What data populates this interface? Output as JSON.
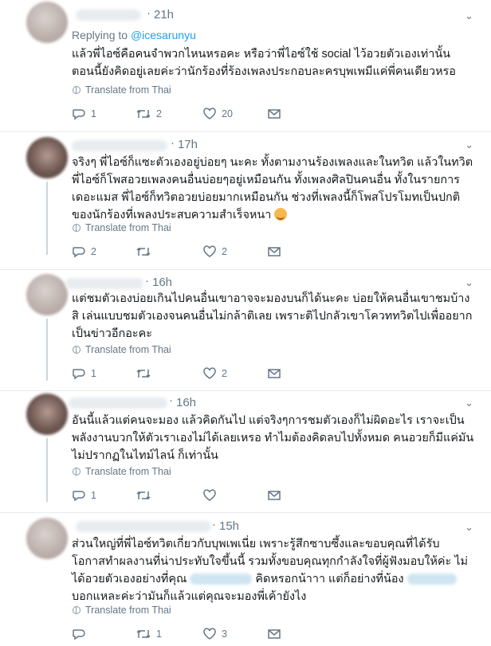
{
  "tweets": [
    {
      "time": "21h",
      "replying_prefix": "Replying to",
      "replying_handle": "@icesarunyu",
      "text": "แล้วพี่ไอซ์คือคนจำพวกไหนหรอคะ หรือว่าพี่ไอซ์ใช้ social ไว้อวยตัวเองเท่านั้น ตอนนี้ยังคิดอยู่เลยค่ะว่านักร้องที่ร้องเพลงประกอบละครบุพเพมีแค่พี่คนเดียวหรอ",
      "translate": "Translate from Thai",
      "replies": "1",
      "retweets": "2",
      "likes": "20"
    },
    {
      "time": "17h",
      "text_before": "จริงๆ พี่ไอซ์ก็แซะตัวเองอยู่บ่อยๆ นะคะ ทั้งตามงานร้องเพลงและในทวิต แล้วในทวิตพี่ไอซ์ก็โพสอวยเพลงคนอื่นบ่อยๆอยู่เหมือนกัน ทั้งเพลงศิลปินคนอื่น ทั้งในรายการเดอะแมส พี่ไอซ์ก็ทวิตอวยบ่อยมากเหมือนกัน ช่วงที่เพลงนี้ก็โพสโปรโมทเป็นปกติของนักร้องที่เพลงประสบความสำเร็จหนา",
      "translate": "Translate from Thai",
      "replies": "2",
      "retweets": "",
      "likes": "2"
    },
    {
      "time": "16h",
      "text": "แต่ชมตัวเองบ่อยเกินไปคนอื่นเขาอาจจะมองบนก็ได้นะคะ บ่อยให้คนอื่นเขาชมบ้างสิ เล่นแบบชมตัวเองจนคนอื่นไม่กล้าติเลย เพราะติไปกลัวเขาโควททวิตไปเพื่ออยากเป็นข่าวอีกอะคะ",
      "translate": "Translate from Thai",
      "replies": "1",
      "retweets": "",
      "likes": "2"
    },
    {
      "time": "16h",
      "text": "อันนี้แล้วแต่คนจะมอง แล้วคิดกันไป แต่จริงๆการชมตัวเองก็ไม่ผิดอะไร เราจะเป็นพลังงานบวกให้ตัวเราเองไม่ได้เลยเหรอ ทำไมต้องคิดลบไปทั้งหมด คนอวยก็มีแค่มันไม่ปรากฏในไทม์ไลน์ ก็เท่านั้น",
      "translate": "Translate from Thai",
      "replies": "1",
      "retweets": "",
      "likes": ""
    },
    {
      "time": "15h",
      "text_line1": "ส่วนใหญ่ที่พี่ไอซ์ทวิตเกี่ยวกับบุพเพเนี่ย เพราะรู้สึกซาบซึ้งและขอบคุณที่ได้รับ โอกาสทำผลงานที่น่าประทับใจขึ้นนี้ รวมทั้งขอบคุณทุกกำลังใจที่ผู้ฟังมอบให้ค่ะ ไม่ได้อวยตัวเองอย่างที่คุณ",
      "text_mid": "คิดหรอกน้าาา แต่ก็อย่างที่น้อง",
      "text_end": "บอกแหละค่ะว่ามันก็แล้วแต่คุณจะมองพี่เค้ายังไง",
      "translate": "Translate from Thai",
      "replies": "",
      "retweets": "1",
      "likes": "3"
    }
  ],
  "icons": {
    "reply": "reply-icon",
    "retweet": "retweet-icon",
    "like": "heart-icon",
    "dm": "envelope-icon",
    "translate": "globe-icon",
    "more": "chevron-down-icon"
  },
  "colors": {
    "link": "#1da1f2",
    "meta": "#657786",
    "divider": "#e6ecf0"
  }
}
